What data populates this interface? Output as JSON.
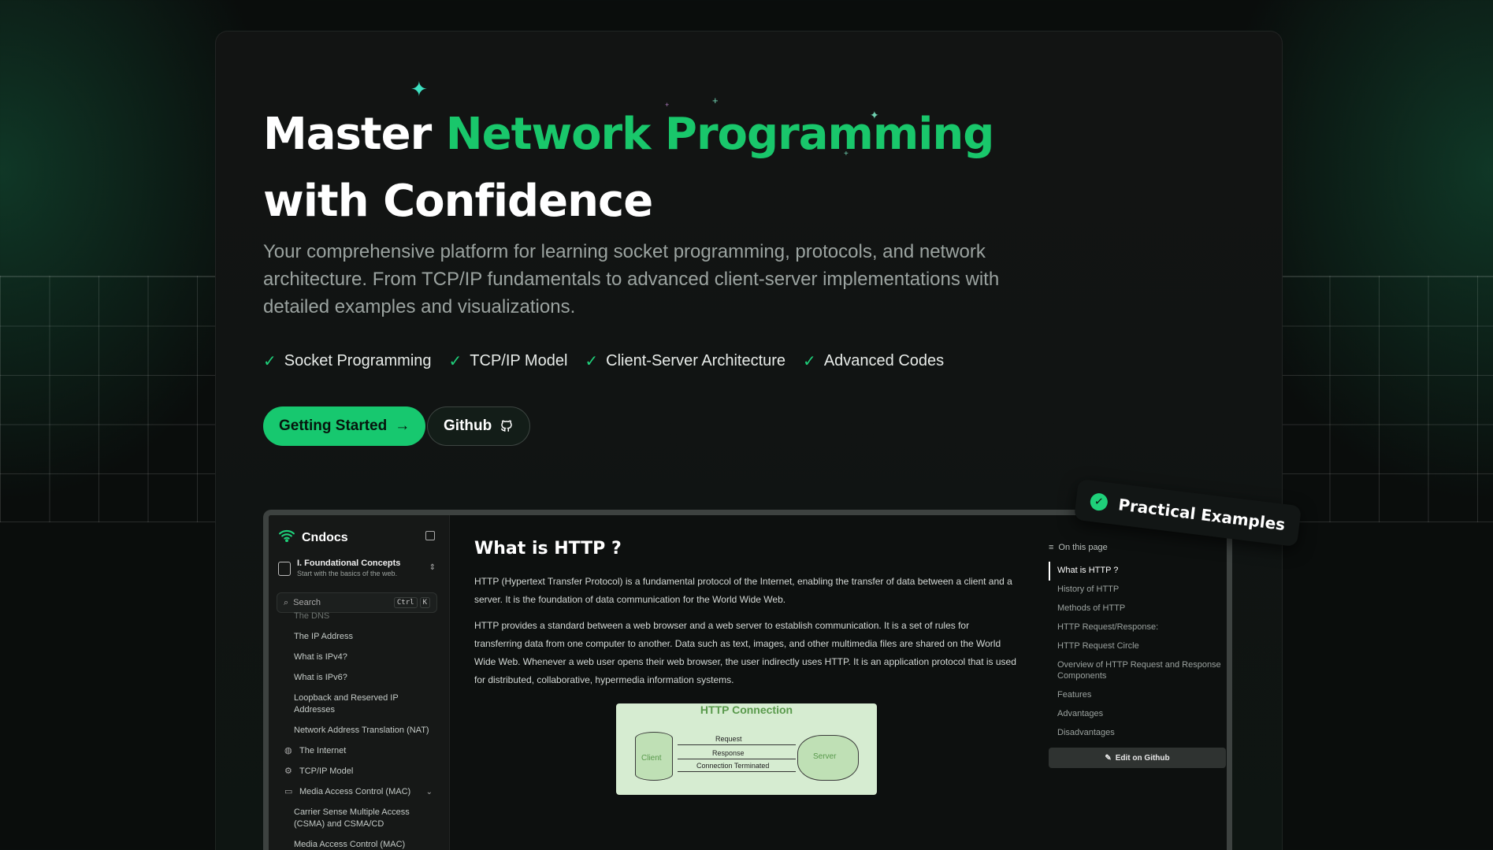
{
  "hero": {
    "title_line1_plain": "Master",
    "title_line1_accent": "Network Programming",
    "title_line2": "with Confidence",
    "subtitle": "Your comprehensive platform for learning socket programming, protocols, and network architecture. From TCP/IP fundamentals to advanced client-server implementations with detailed examples and visualizations.",
    "features": [
      "Socket Programming",
      "TCP/IP Model",
      "Client-Server Architecture",
      "Advanced Codes"
    ],
    "primary_button": "Getting Started",
    "secondary_button": "Github",
    "badge": "Practical Examples"
  },
  "preview": {
    "app_name": "Cndocs",
    "section_title": "I. Foundational Concepts",
    "section_subtitle": "Start with the basics of the web.",
    "search_placeholder": "Search",
    "search_keys": [
      "Ctrl",
      "K"
    ],
    "nav": [
      {
        "label": "The DNS",
        "type": "sub",
        "faded": true
      },
      {
        "label": "The IP Address",
        "type": "sub"
      },
      {
        "label": "What is IPv4?",
        "type": "sub"
      },
      {
        "label": "What is IPv6?",
        "type": "sub"
      },
      {
        "label": "Loopback and Reserved IP Addresses",
        "type": "sub"
      },
      {
        "label": "Network Address Translation (NAT)",
        "type": "sub"
      },
      {
        "label": "The Internet",
        "type": "top",
        "icon": "globe-icon"
      },
      {
        "label": "TCP/IP Model",
        "type": "top",
        "icon": "network-icon"
      },
      {
        "label": "Media Access Control (MAC)",
        "type": "top",
        "icon": "monitor-icon",
        "expanded": true
      },
      {
        "label": "Carrier Sense Multiple Access (CSMA) and CSMA/CD",
        "type": "sub"
      },
      {
        "label": "Media Access Control (MAC)",
        "type": "sub"
      }
    ],
    "doc_title": "What is HTTP ?",
    "doc_paragraphs": [
      "HTTP (Hypertext Transfer Protocol) is a fundamental protocol of the Internet, enabling the transfer of data between a client and a server. It is the foundation of data communication for the World Wide Web.",
      "HTTP provides a standard between a web browser and a web server to establish communication. It is a set of rules for transferring data from one computer to another. Data such as text, images, and other multimedia files are shared on the World Wide Web. Whenever a web user opens their web browser, the user indirectly uses HTTP. It is an application protocol that is used for distributed, collaborative, hypermedia information systems."
    ],
    "diagram": {
      "title": "HTTP Connection",
      "client": "Client",
      "server": "Server",
      "request": "Request",
      "response": "Response",
      "terminated": "Connection Terminated"
    },
    "toc_title": "On this page",
    "toc": [
      "What is HTTP ?",
      "History of HTTP",
      "Methods of HTTP",
      "HTTP Request/Response:",
      "HTTP Request Circle",
      "Overview of HTTP Request and Response Components",
      "Features",
      "Advantages",
      "Disadvantages"
    ],
    "edit_button": "Edit on Github"
  },
  "colors": {
    "accent": "#19c76b",
    "background": "#0a0d0c"
  }
}
